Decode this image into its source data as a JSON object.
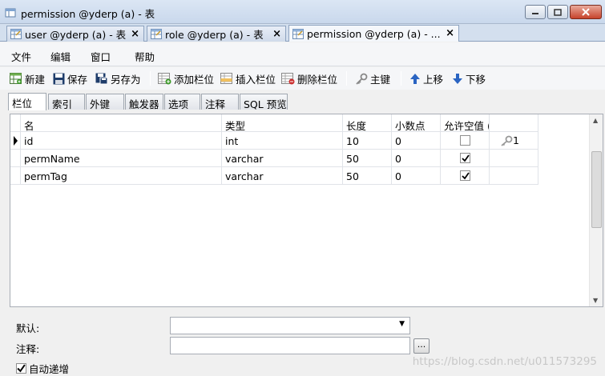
{
  "window": {
    "title": "permission @yderp (a) - 表"
  },
  "doc_tabs": [
    {
      "label": "user @yderp (a) - 表",
      "close": "×"
    },
    {
      "label": "role @yderp (a) - 表",
      "close": "×"
    },
    {
      "label": "permission @yderp (a) - ...",
      "close": "×"
    }
  ],
  "menu": [
    "文件",
    "编辑",
    "窗口",
    "帮助"
  ],
  "toolbar": {
    "new": "新建",
    "save": "保存",
    "save_as": "另存为",
    "add_field": "添加栏位",
    "insert_field": "插入栏位",
    "delete_field": "删除栏位",
    "primary_key": "主键",
    "move_up": "上移",
    "move_down": "下移"
  },
  "field_tabs": [
    "栏位",
    "索引",
    "外键",
    "触发器",
    "选项",
    "注释",
    "SQL 预览"
  ],
  "grid": {
    "columns": [
      "名",
      "类型",
      "长度",
      "小数点",
      "允许空值 (",
      ""
    ],
    "rows": [
      {
        "name": "id",
        "type": "int",
        "length": "10",
        "decimals": "0",
        "allow_null": false,
        "key": "1"
      },
      {
        "name": "permName",
        "type": "varchar",
        "length": "50",
        "decimals": "0",
        "allow_null": true,
        "key": ""
      },
      {
        "name": "permTag",
        "type": "varchar",
        "length": "50",
        "decimals": "0",
        "allow_null": true,
        "key": ""
      }
    ]
  },
  "bottom": {
    "default_label": "默认:",
    "comment_label": "注释:",
    "comment_value": "",
    "more_button": "...",
    "auto_increment_label": "自动递增",
    "auto_increment_checked": true,
    "watermark": "https://blog.csdn.net/u011573295"
  }
}
